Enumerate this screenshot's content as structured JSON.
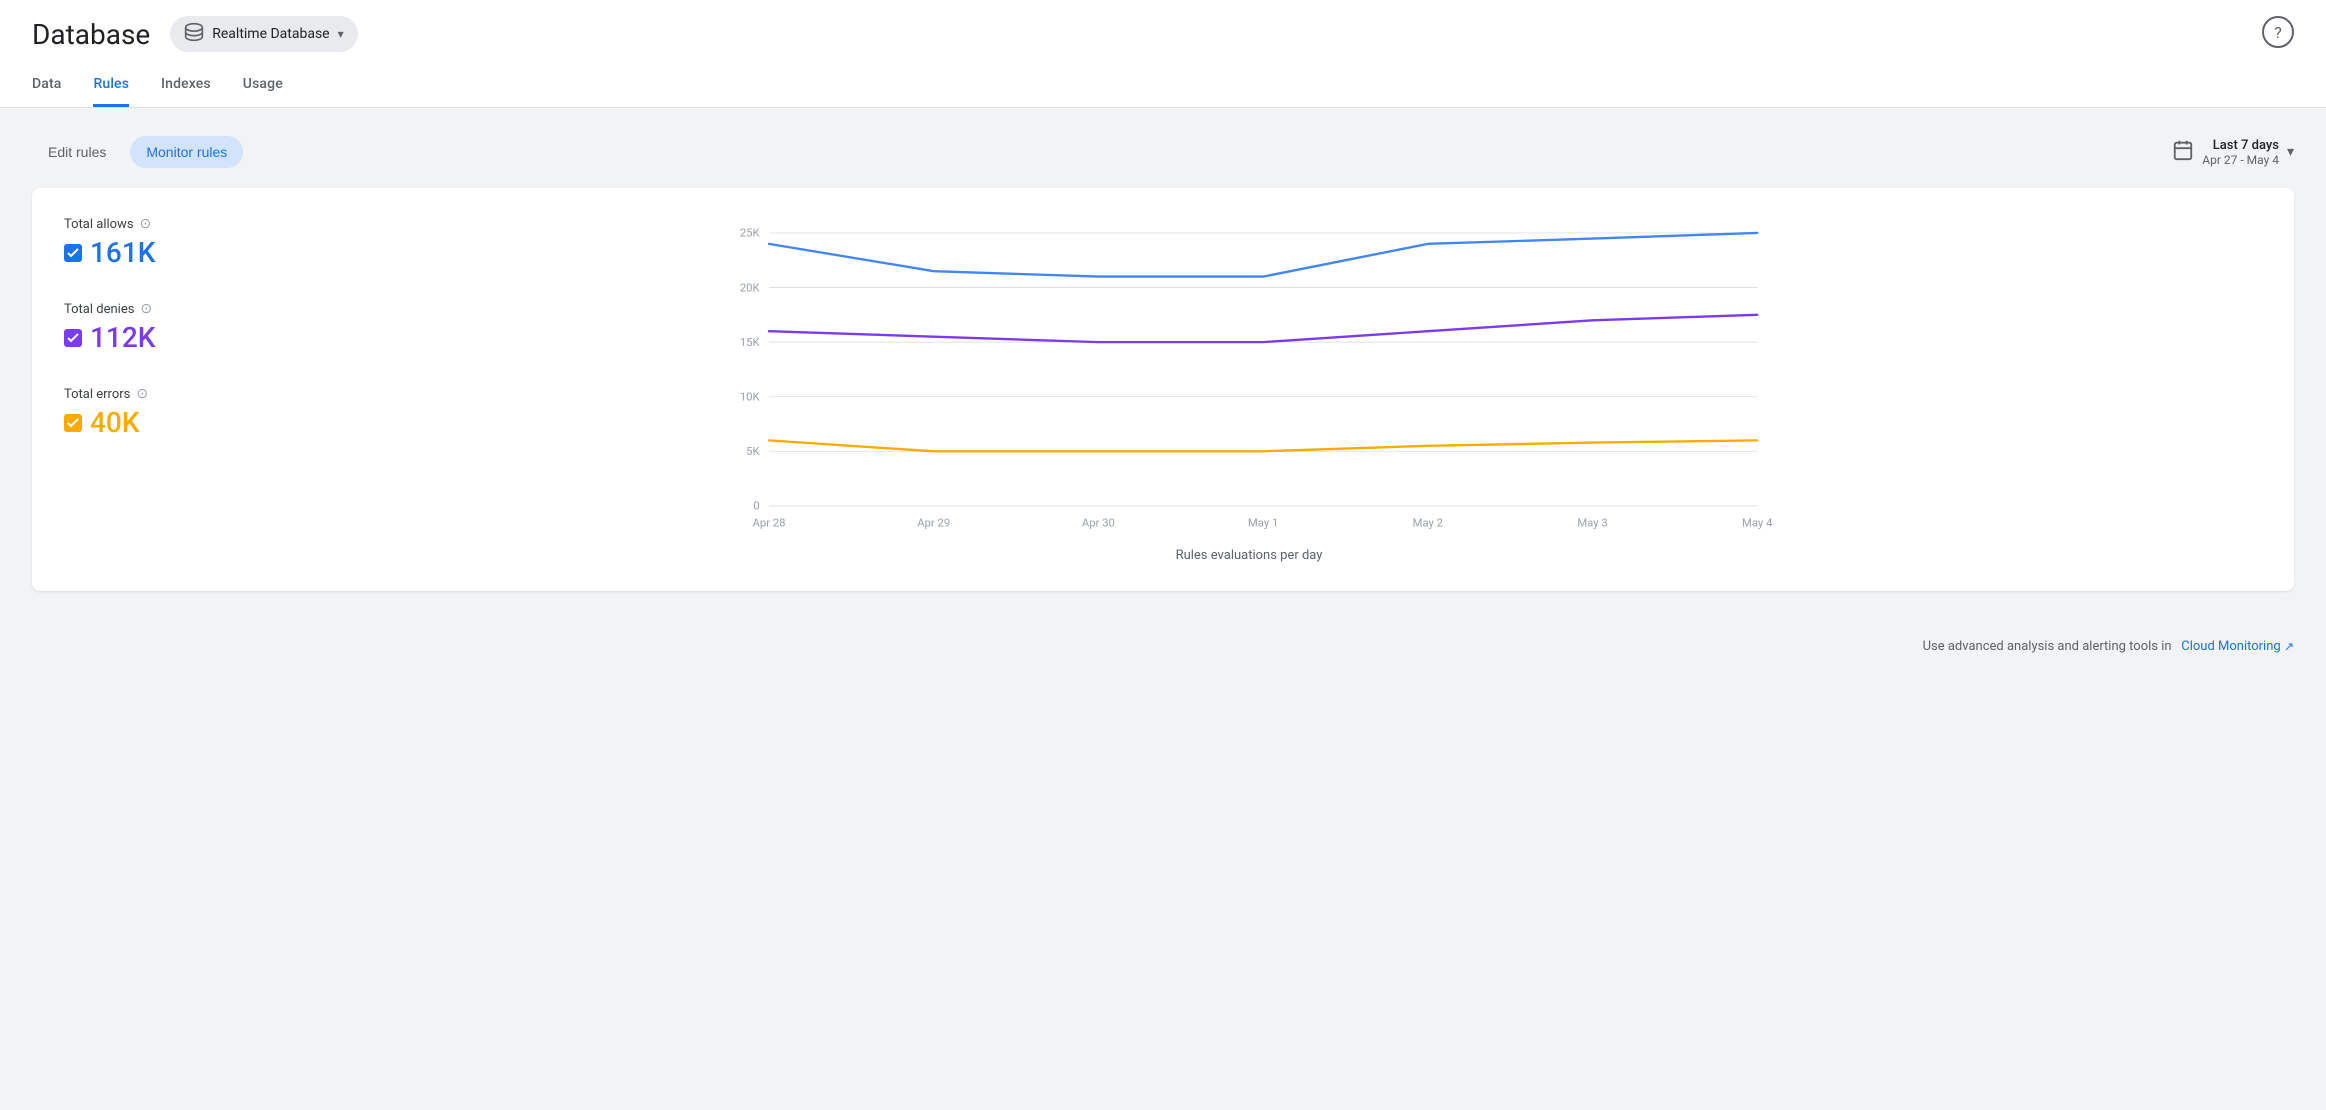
{
  "header": {
    "title": "Database",
    "db_selector": {
      "label": "Realtime Database",
      "icon": "database-icon"
    }
  },
  "nav": {
    "tabs": [
      {
        "id": "data",
        "label": "Data",
        "active": false
      },
      {
        "id": "rules",
        "label": "Rules",
        "active": true
      },
      {
        "id": "indexes",
        "label": "Indexes",
        "active": false
      },
      {
        "id": "usage",
        "label": "Usage",
        "active": false
      }
    ]
  },
  "toolbar": {
    "edit_rules_label": "Edit rules",
    "monitor_rules_label": "Monitor rules",
    "date_range": {
      "label_primary": "Last 7 days",
      "label_secondary": "Apr 27 - May 4"
    }
  },
  "chart": {
    "legend": [
      {
        "id": "allows",
        "label": "Total allows",
        "value": "161K",
        "color": "blue",
        "checkbox_color": "blue"
      },
      {
        "id": "denies",
        "label": "Total denies",
        "value": "112K",
        "color": "purple",
        "checkbox_color": "purple"
      },
      {
        "id": "errors",
        "label": "Total errors",
        "value": "40K",
        "color": "yellow",
        "checkbox_color": "yellow"
      }
    ],
    "y_axis": [
      "25K",
      "20K",
      "15K",
      "10K",
      "5K",
      "0"
    ],
    "x_axis": [
      "Apr 28",
      "Apr 29",
      "Apr 30",
      "May 1",
      "May 2",
      "May 3",
      "May 4"
    ],
    "x_label": "Rules evaluations per day",
    "series": {
      "allows": [
        24000,
        21500,
        21000,
        21000,
        24000,
        24500,
        25000
      ],
      "denies": [
        16000,
        15500,
        15000,
        15000,
        16000,
        17000,
        17500
      ],
      "errors": [
        6000,
        5000,
        5000,
        5000,
        5500,
        5800,
        6000
      ]
    }
  },
  "footer": {
    "text": "Use advanced analysis and alerting tools in",
    "link_text": "Cloud Monitoring",
    "link_icon": "external-link-icon"
  }
}
